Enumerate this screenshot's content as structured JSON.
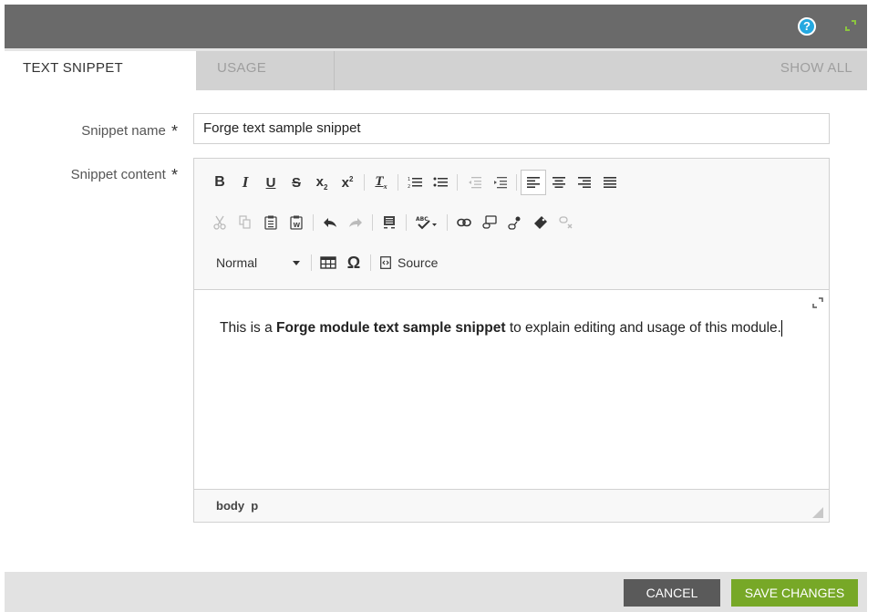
{
  "tabs": {
    "text_snippet": "TEXT SNIPPET",
    "usage": "USAGE",
    "show_all": "SHOW ALL"
  },
  "form": {
    "name_label": "Snippet name",
    "name_value": "Forge text sample snippet",
    "content_label": "Snippet content",
    "required_mark": "*"
  },
  "editor": {
    "format_select": "Normal",
    "source_label": "Source",
    "content_before": "This is a ",
    "content_bold": "Forge module text sample snippet",
    "content_after": " to explain editing and usage of this module.",
    "path": "body  p"
  },
  "footer": {
    "cancel": "CANCEL",
    "save": "SAVE CHANGES"
  },
  "colors": {
    "titlebar": "#6a6a6a",
    "help": "#24a8e0",
    "accent_green": "#77a827",
    "cancel": "#5a5a5a"
  }
}
